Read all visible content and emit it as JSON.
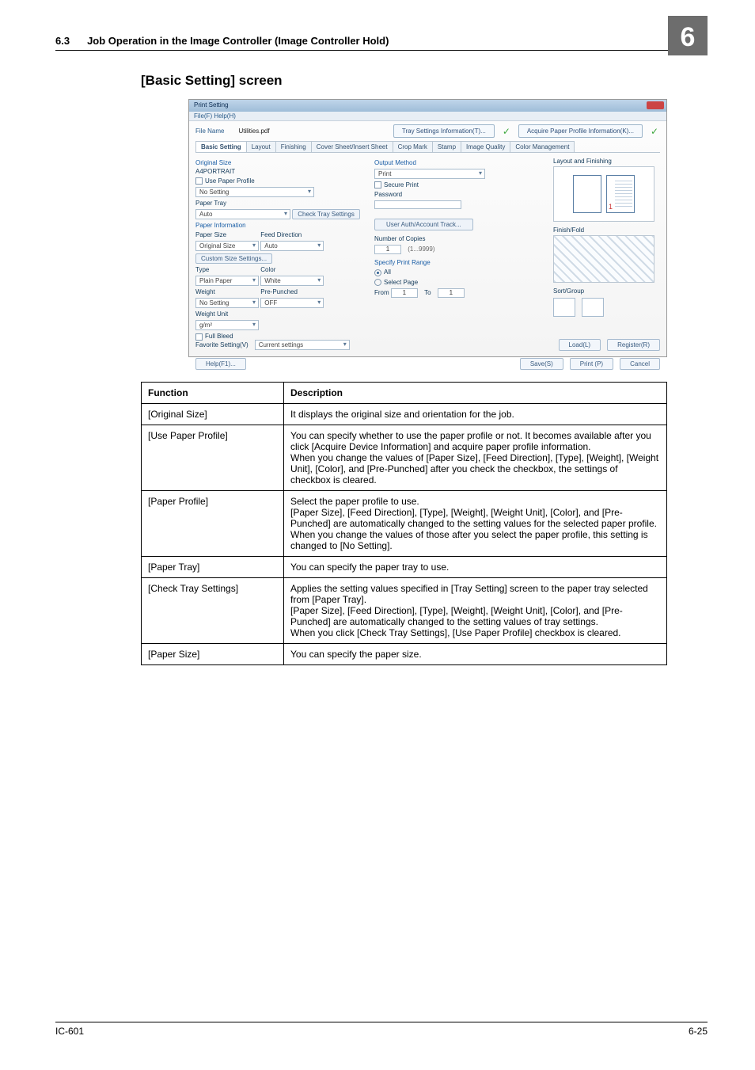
{
  "header": {
    "section": "6.3",
    "title": "Job Operation in the Image Controller (Image Controller Hold)",
    "chapter": "6"
  },
  "subhead": "[Basic Setting] screen",
  "shot": {
    "window_title": "Print Setting",
    "menu": "File(F)  Help(H)",
    "file_label": "File Name",
    "file_name": "Utilities.pdf",
    "tray_info_btn": "Tray Settings Information(T)...",
    "acquire_btn": "Acquire Paper Profile Information(K)...",
    "tabs": [
      "Basic Setting",
      "Layout",
      "Finishing",
      "Cover Sheet/Insert Sheet",
      "Crop Mark",
      "Stamp",
      "Image Quality",
      "Color Management"
    ],
    "left": {
      "original_size": "Original Size",
      "original_size_val": "A4PORTRAIT",
      "use_paper_profile": "Use Paper Profile",
      "no_setting": "No Setting",
      "paper_tray": "Paper Tray",
      "paper_tray_val": "Auto",
      "check_tray": "Check Tray Settings",
      "paper_info": "Paper Information",
      "paper_size": "Paper Size",
      "paper_size_val": "Original Size",
      "feed_dir": "Feed Direction",
      "feed_dir_val": "Auto",
      "custom": "Custom Size Settings...",
      "type": "Type",
      "type_val": "Plain Paper",
      "color": "Color",
      "color_val": "White",
      "weight": "Weight",
      "weight_val": "No Setting",
      "prepunched": "Pre-Punched",
      "prepunched_val": "OFF",
      "weight_unit": "Weight Unit",
      "weight_unit_val": "g/m²",
      "full_bleed": "Full Bleed"
    },
    "mid": {
      "output_method": "Output Method",
      "output_method_val": "Print",
      "secure": "Secure Print",
      "password": "Password",
      "user_auth": "User Auth/Account Track...",
      "copies": "Number of Copies",
      "copies_val": "1",
      "copies_range": "(1...9999)",
      "range": "Specify Print Range",
      "all": "All",
      "select_page": "Select Page",
      "from": "From",
      "to": "To",
      "one": "1"
    },
    "right": {
      "layout_fin": "Layout and Finishing",
      "finish_fold": "Finish/Fold",
      "sort_group": "Sort/Group"
    },
    "footer": {
      "fav": "Favorite Setting(V)",
      "fav_val": "Current settings",
      "load": "Load(L)",
      "register": "Register(R)",
      "help": "Help(F1)...",
      "save": "Save(S)",
      "print": "Print (P)",
      "cancel": "Cancel"
    }
  },
  "table": {
    "head": {
      "c1": "Function",
      "c2": "Description"
    },
    "rows": [
      {
        "f": "[Original Size]",
        "d": "It displays the original size and orientation for the job."
      },
      {
        "f": "[Use Paper Profile]",
        "d": "You can specify whether to use the paper profile or not. It becomes available after you click [Acquire Device Information] and acquire paper profile information.\nWhen you change the values of [Paper Size], [Feed Direction], [Type], [Weight], [Weight Unit], [Color], and [Pre-Punched] after you check the checkbox, the settings of checkbox is cleared."
      },
      {
        "f": "[Paper Profile]",
        "d": "Select the paper profile to use.\n[Paper Size], [Feed Direction], [Type], [Weight], [Weight Unit], [Color], and [Pre-Punched] are automatically changed to the setting values for the selected paper profile.\nWhen you change the values of those after you select the paper profile, this setting is changed to [No Setting]."
      },
      {
        "f": "[Paper Tray]",
        "d": "You can specify the paper tray to use."
      },
      {
        "f": "[Check Tray Settings]",
        "d": "Applies the setting values specified in [Tray Setting] screen to the paper tray selected from [Paper Tray].\n[Paper Size], [Feed Direction], [Type], [Weight], [Weight Unit], [Color], and [Pre-Punched] are automatically changed to the setting values of tray settings.\nWhen you click [Check Tray Settings], [Use Paper Profile] checkbox is cleared."
      },
      {
        "f": "[Paper Size]",
        "d": "You can specify the paper size."
      }
    ]
  },
  "footer": {
    "left": "IC-601",
    "right": "6-25"
  }
}
